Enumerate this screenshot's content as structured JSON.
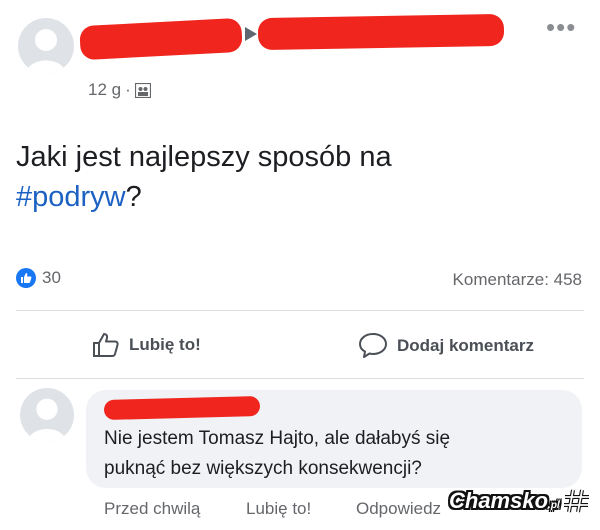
{
  "post": {
    "time": "12 g",
    "separator": "·",
    "privacy_icon": "friends-icon",
    "text_main": "Jaki jest najlepszy sposób na",
    "hashtag": "#podryw",
    "text_end": "?"
  },
  "reactions": {
    "like_count": "30",
    "comments_label": "Komentarze: 458"
  },
  "actions": {
    "like_label": "Lubię to!",
    "comment_label": "Dodaj komentarz"
  },
  "comment": {
    "line1": "Nie jestem Tomasz Hajto, ale dałabyś się",
    "line2": "puknąć bez większych konsekwencji?",
    "time": "Przed chwilą",
    "like_label": "Lubię to!",
    "reply_label": "Odpowiedz"
  },
  "watermark": {
    "brand": "Chamsko",
    "suffix": ".pl"
  },
  "colors": {
    "accent": "#1877f2",
    "hashtag": "#1d62c3",
    "redaction": "#f0261e"
  }
}
